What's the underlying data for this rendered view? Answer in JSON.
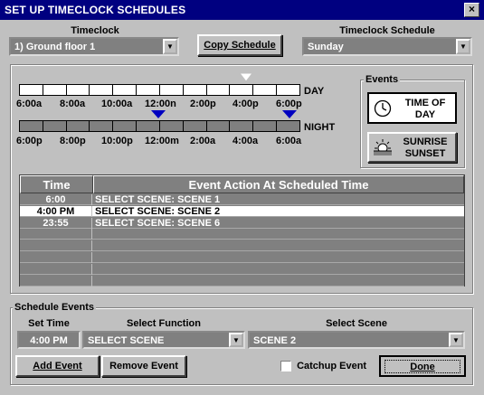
{
  "window": {
    "title": "SET UP TIMECLOCK SCHEDULES",
    "close_glyph": "×"
  },
  "timeclock": {
    "label": "Timeclock",
    "value": "1) Ground floor 1"
  },
  "copy_schedule": {
    "label": "Copy Schedule"
  },
  "schedule": {
    "label": "Timeclock Schedule",
    "value": "Sunday"
  },
  "timeline": {
    "day_label": "DAY",
    "night_label": "NIGHT",
    "day_ticks": [
      "6:00a",
      "8:00a",
      "10:00a",
      "12:00n",
      "2:00p",
      "4:00p",
      "6:00p"
    ],
    "night_ticks": [
      "6:00p",
      "8:00p",
      "10:00p",
      "12:00m",
      "2:00a",
      "4:00a",
      "6:00a"
    ]
  },
  "events": {
    "label": "Events",
    "time_of_day": [
      "TIME OF",
      "DAY"
    ],
    "sunrise_sunset": [
      "SUNRISE",
      "SUNSET"
    ]
  },
  "table": {
    "headers": [
      "Time",
      "Event Action At Scheduled Time"
    ],
    "rows": [
      {
        "time": "6:00",
        "action": "SELECT SCENE: SCENE 1"
      },
      {
        "time": "4:00 PM",
        "action": "SELECT SCENE: SCENE 2"
      },
      {
        "time": "23:55",
        "action": "SELECT SCENE: SCENE 6"
      }
    ],
    "selected_row": 1
  },
  "schedule_events": {
    "label": "Schedule Events",
    "set_time_label": "Set Time",
    "set_time_value": "4:00 PM",
    "function_label": "Select Function",
    "function_value": "SELECT SCENE",
    "scene_label": "Select Scene",
    "scene_value": "SCENE 2",
    "add_event": "Add Event",
    "remove_event": "Remove Event",
    "catchup_label": "Catchup Event",
    "catchup_checked": false,
    "done": "Done"
  },
  "colors": {
    "title_bg": "#000080",
    "window_bg": "#c0c0c0",
    "marker_blue": "#0000c0"
  }
}
